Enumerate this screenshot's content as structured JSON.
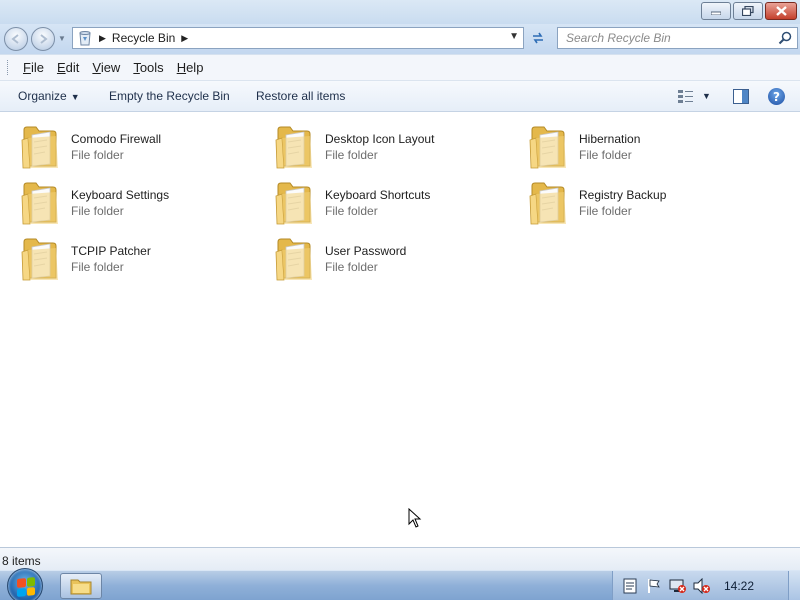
{
  "window": {
    "caption_buttons": {
      "minimize": "minimize-icon",
      "maximize": "restore-icon",
      "close": "close-icon"
    }
  },
  "address": {
    "location": "Recycle Bin",
    "search_placeholder": "Search Recycle Bin"
  },
  "menu": {
    "items": [
      {
        "label": "File",
        "mnemonic": "F"
      },
      {
        "label": "Edit",
        "mnemonic": "E"
      },
      {
        "label": "View",
        "mnemonic": "V"
      },
      {
        "label": "Tools",
        "mnemonic": "T"
      },
      {
        "label": "Help",
        "mnemonic": "H"
      }
    ]
  },
  "commands": {
    "organize": "Organize",
    "empty": "Empty the Recycle Bin",
    "restore": "Restore all items"
  },
  "items": [
    {
      "name": "Comodo Firewall",
      "type": "File folder"
    },
    {
      "name": "Desktop Icon Layout",
      "type": "File folder"
    },
    {
      "name": "Hibernation",
      "type": "File folder"
    },
    {
      "name": "Keyboard Settings",
      "type": "File folder"
    },
    {
      "name": "Keyboard Shortcuts",
      "type": "File folder"
    },
    {
      "name": "Registry Backup",
      "type": "File folder"
    },
    {
      "name": "TCPIP Patcher",
      "type": "File folder"
    },
    {
      "name": "User Password",
      "type": "File folder"
    }
  ],
  "status": {
    "text": "8 items"
  },
  "taskbar": {
    "clock": "14:22"
  },
  "colors": {
    "folder": "#f3d27a",
    "titlebar": "#c9dcf0",
    "taskbar": "#8fb0d8",
    "close": "#c4402c"
  }
}
